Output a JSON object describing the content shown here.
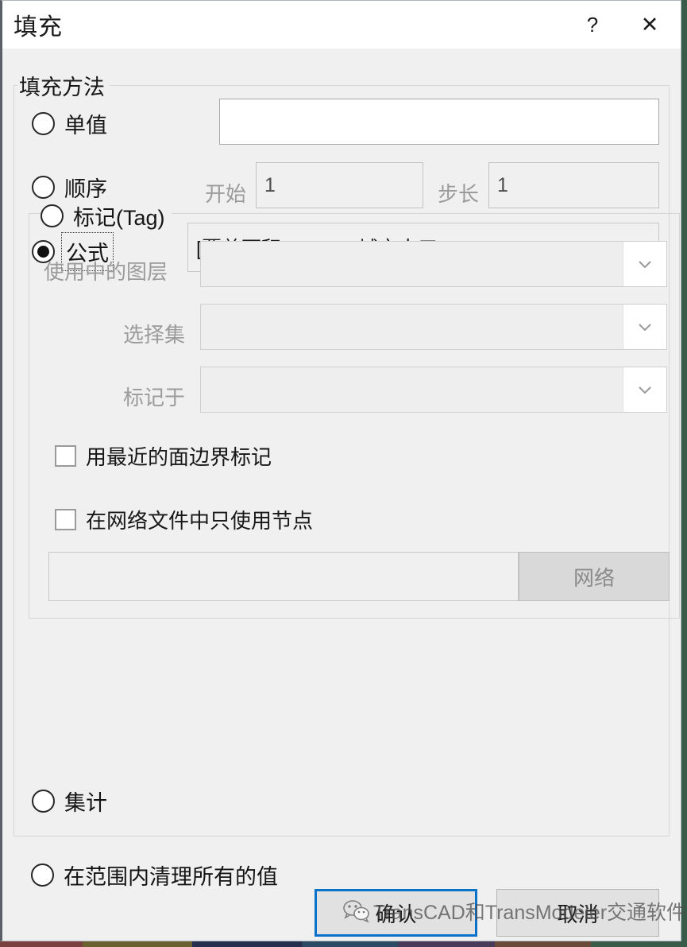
{
  "window": {
    "title": "填充",
    "help_label": "?",
    "close_label": "✕"
  },
  "main_group": {
    "legend": "填充方法"
  },
  "methods": [
    {
      "label": "单值",
      "selected": false
    },
    {
      "label": "顺序",
      "selected": false
    },
    {
      "label": "公式",
      "selected": true
    },
    {
      "label": "标记(Tag)",
      "selected": false
    },
    {
      "label": "集计",
      "selected": false
    },
    {
      "label": "在范围内清理所有的值",
      "selected": false
    }
  ],
  "single_value": {
    "value": "",
    "placeholder": ""
  },
  "sequence": {
    "start_label": "开始",
    "start_value": "1",
    "step_label": "步长",
    "step_value": "1"
  },
  "formula": {
    "value": "[覆盖面积]/ Area* [城市人口]"
  },
  "tag": {
    "active_layer_label": "使用中的图层",
    "active_layer_value": "",
    "selection_set_label": "选择集",
    "selection_set_value": "",
    "tag_with_label": "标记于",
    "tag_with_value": "",
    "nearest_area_checkbox": "用最近的面边界标记",
    "nodes_only_checkbox": "在网络文件中只使用节点",
    "network_file_value": "",
    "network_button": "网络"
  },
  "footer": {
    "ok_label": "确认",
    "cancel_label": "取消"
  },
  "watermark": {
    "text": "TransCAD和TransModeler交通软件",
    "icon": "wechat-icon"
  }
}
